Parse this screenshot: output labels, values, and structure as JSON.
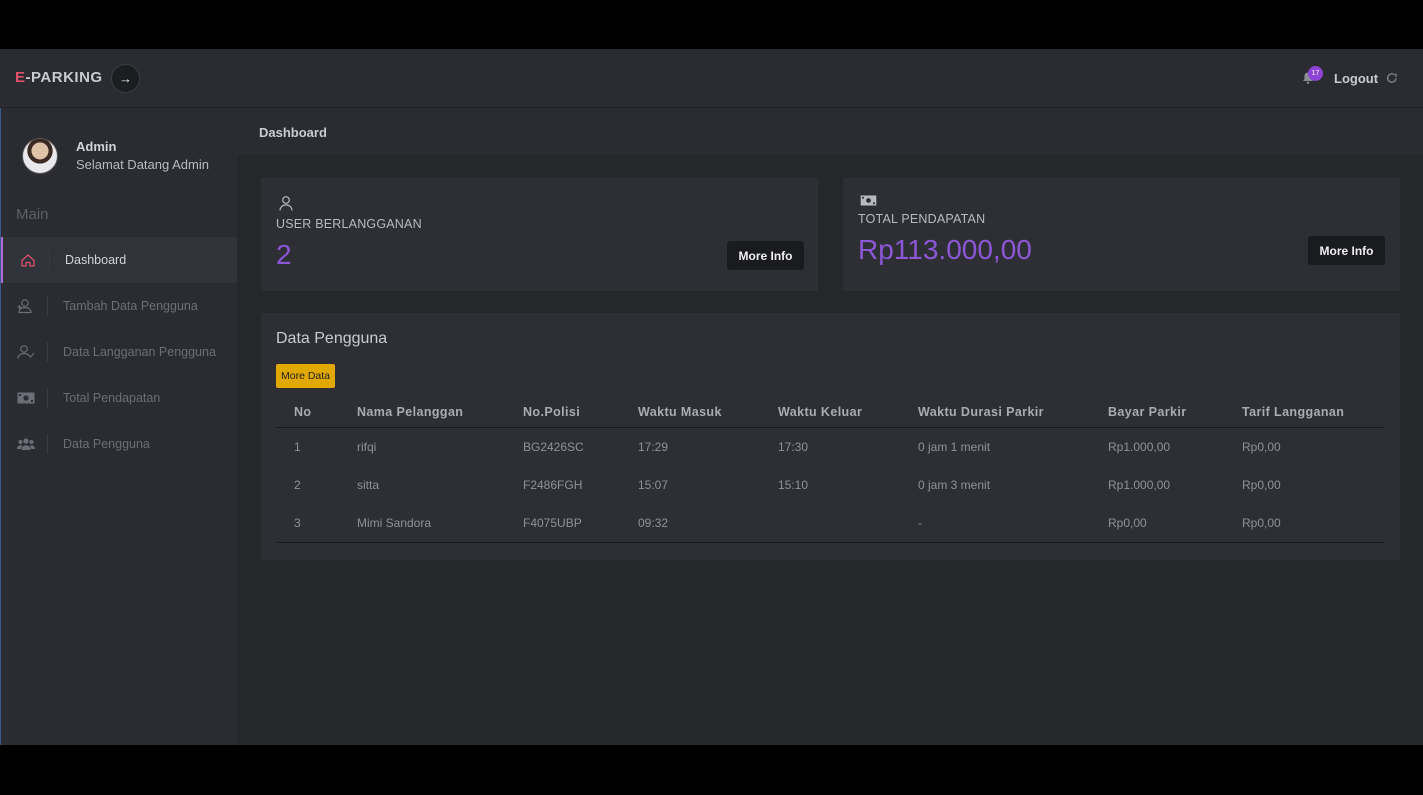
{
  "brand": {
    "prefix": "E",
    "suffix": "-PARKING"
  },
  "topbar": {
    "toggle_icon": "→",
    "notification_count": "17",
    "logout_label": "Logout"
  },
  "sidebar": {
    "user_name": "Admin",
    "user_greeting": "Selamat Datang Admin",
    "menu_heading": "Main",
    "items": [
      {
        "label": "Dashboard",
        "icon": "home-icon",
        "active": true
      },
      {
        "label": "Tambah Data Pengguna",
        "icon": "user-plus-icon"
      },
      {
        "label": "Data Langganan Pengguna",
        "icon": "user-check-icon"
      },
      {
        "label": "Total Pendapatan",
        "icon": "money-icon"
      },
      {
        "label": "Data Pengguna",
        "icon": "users-icon"
      }
    ]
  },
  "page": {
    "title": "Dashboard"
  },
  "cards": [
    {
      "label": "USER BERLANGGANAN",
      "value": "2",
      "button": "More Info",
      "icon": "user-icon"
    },
    {
      "label": "TOTAL PENDAPATAN",
      "value": "Rp113.000,00",
      "button": "More Info",
      "icon": "money-icon"
    }
  ],
  "data_table": {
    "title": "Data Pengguna",
    "more_button": "More Data",
    "columns": [
      "No",
      "Nama Pelanggan",
      "No.Polisi",
      "Waktu Masuk",
      "Waktu Keluar",
      "Waktu Durasi Parkir",
      "Bayar Parkir",
      "Tarif Langganan"
    ],
    "rows": [
      [
        "1",
        "rifqi",
        "BG2426SC",
        "17:29",
        "17:30",
        "0 jam 1 menit",
        "Rp1.000,00",
        "Rp0,00"
      ],
      [
        "2",
        "sitta",
        "F2486FGH",
        "15:07",
        "15:10",
        "0 jam 3 menit",
        "Rp1.000,00",
        "Rp0,00"
      ],
      [
        "3",
        "Mimi Sandora",
        "F4075UBP",
        "09:32",
        "",
        "-",
        "Rp0,00",
        "Rp0,00"
      ]
    ]
  },
  "colors": {
    "accent": "#8c57d6",
    "brand_e": "#e2506b",
    "more_data": "#e0a800"
  }
}
